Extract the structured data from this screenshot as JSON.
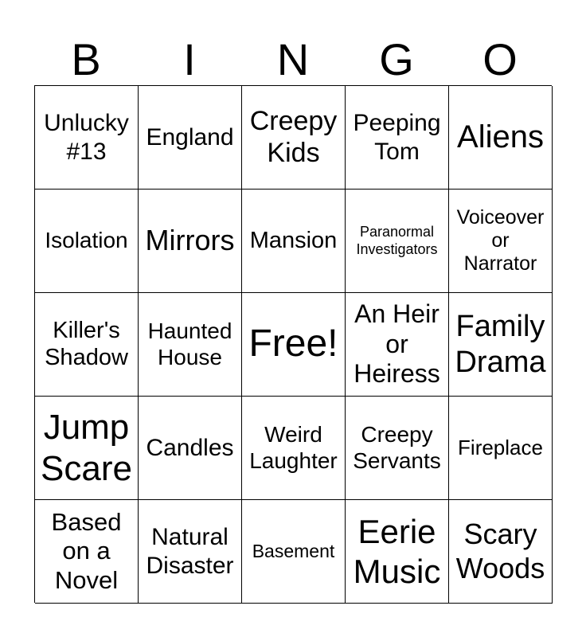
{
  "header": [
    "B",
    "I",
    "N",
    "G",
    "O"
  ],
  "cells": [
    "Unlucky\n#13",
    "England",
    "Creepy\nKids",
    "Peeping\nTom",
    "Aliens",
    "Isolation",
    "Mirrors",
    "Mansion",
    "Paranormal\nInvestigators",
    "Voiceover\nor\nNarrator",
    "Killer's\nShadow",
    "Haunted\nHouse",
    "Free!",
    "An Heir\nor\nHeiress",
    "Family\nDrama",
    "Jump\nScare",
    "Candles",
    "Weird\nLaughter",
    "Creepy\nServants",
    "Fireplace",
    "Based\non a\nNovel",
    "Natural\nDisaster",
    "Basement",
    "Eerie\nMusic",
    "Scary\nWoods"
  ]
}
